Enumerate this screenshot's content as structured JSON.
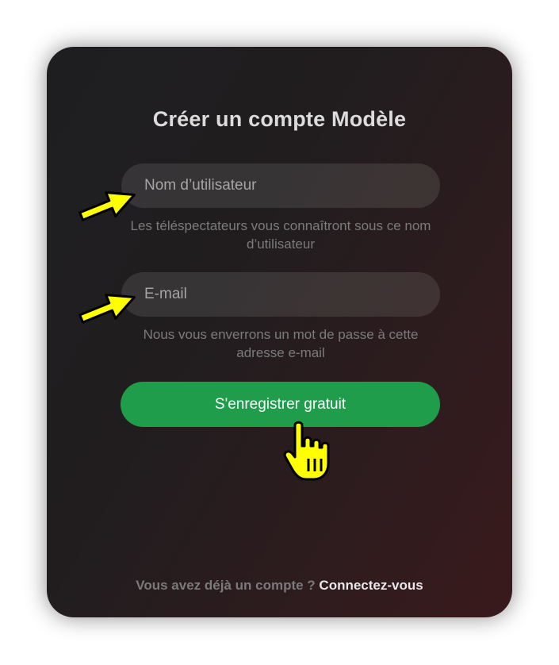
{
  "form": {
    "title": "Créer un compte Modèle",
    "username": {
      "placeholder": "Nom d’utilisateur",
      "hint": "Les téléspectateurs vous connaîtront sous ce nom d’utilisateur"
    },
    "email": {
      "placeholder": "E-mail",
      "hint": "Nous vous enverrons un mot de passe à cette adresse e-mail"
    },
    "register_label": "S'enregistrer gratuit"
  },
  "footer": {
    "prompt": "Vous avez déjà un compte ? ",
    "login_label": "Connectez-vous"
  },
  "annotations": {
    "arrow_icon": "yellow-pointer-arrow-icon",
    "hand_icon": "yellow-hand-cursor-icon",
    "highlight_color": "#ffff00"
  },
  "colors": {
    "accent_green": "#1f9d4a",
    "card_background": "#211d1f"
  }
}
